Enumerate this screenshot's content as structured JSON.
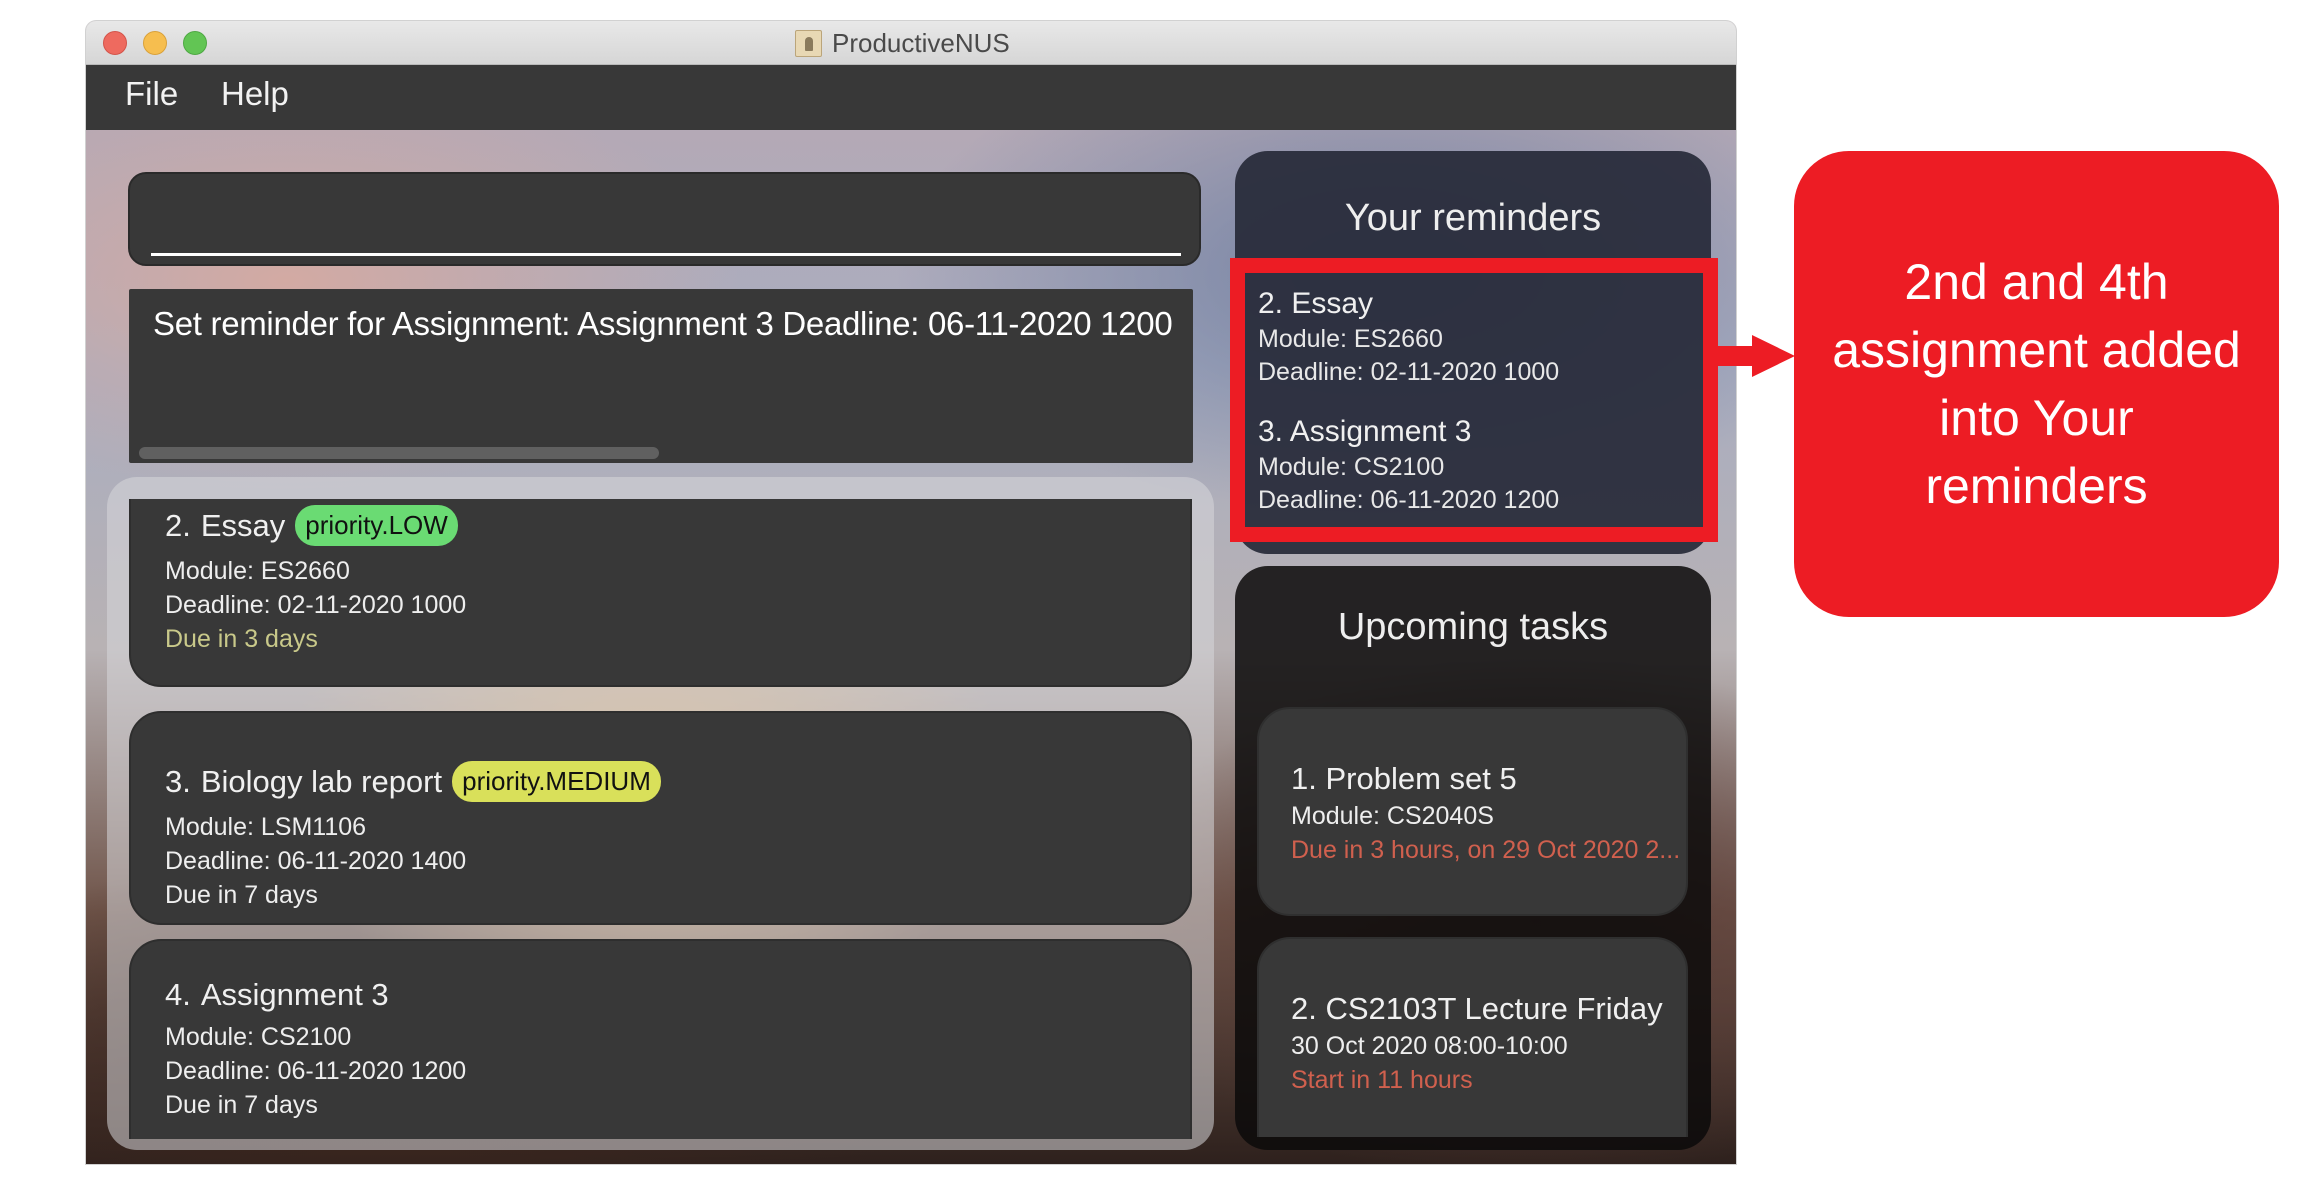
{
  "window": {
    "title": "ProductiveNUS",
    "app_icon": "contacts-book-icon"
  },
  "menu": {
    "items": [
      {
        "label": "File"
      },
      {
        "label": "Help"
      }
    ]
  },
  "command": {
    "value": "",
    "placeholder": ""
  },
  "result": {
    "message": "Set reminder for Assignment: Assignment 3 Deadline: 06-11-2020 1200"
  },
  "assignments": [
    {
      "index": "2.",
      "name": "Essay",
      "priority": "priority.LOW",
      "priority_color": "#6adb73",
      "module": "Module: ES2660",
      "deadline": "Deadline: 02-11-2020 1000",
      "due": "Due in 3 days",
      "due_color": "#c9c98a"
    },
    {
      "index": "3.",
      "name": "Biology lab report",
      "priority": "priority.MEDIUM",
      "priority_color": "#d9e05a",
      "module": "Module: LSM1106",
      "deadline": "Deadline: 06-11-2020 1400",
      "due": "Due in 7 days",
      "due_color": "#eeeeee"
    },
    {
      "index": "4.",
      "name": "Assignment 3",
      "priority": "",
      "module": "Module: CS2100",
      "deadline": "Deadline: 06-11-2020 1200",
      "due": "Due in 7 days",
      "due_color": "#eeeeee"
    }
  ],
  "reminders": {
    "title": "Your reminders",
    "items": [
      {
        "title": "2.  Essay",
        "module": "Module: ES2660",
        "deadline": "Deadline: 02-11-2020 1000"
      },
      {
        "title": "3.  Assignment 3",
        "module": "Module: CS2100",
        "deadline": "Deadline: 06-11-2020 1200"
      }
    ]
  },
  "upcoming": {
    "title": "Upcoming tasks",
    "items": [
      {
        "title": "1.  Problem set 5",
        "detail": "Module: CS2040S",
        "status": "Due in 3 hours, on 29 Oct 2020 2..."
      },
      {
        "title": "2.  CS2103T Lecture Friday",
        "detail": "30 Oct 2020 08:00-10:00",
        "status": "Start in 11 hours"
      }
    ]
  },
  "annotation": {
    "text": "2nd and 4th assignment added into Your reminders",
    "color": "#ed1c24"
  }
}
